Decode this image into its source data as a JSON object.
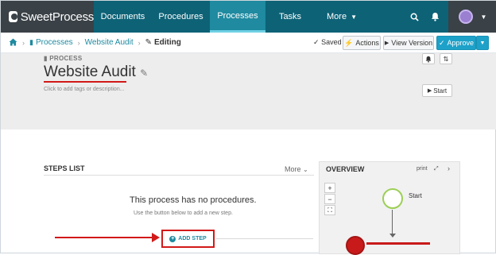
{
  "app": {
    "logo_text": "SweetProcess"
  },
  "nav": {
    "items": [
      {
        "label": "Documents"
      },
      {
        "label": "Procedures"
      },
      {
        "label": "Processes"
      },
      {
        "label": "Tasks"
      },
      {
        "label": "More"
      }
    ],
    "active": "Processes",
    "icons": [
      "search-icon",
      "bell-icon",
      "avatar",
      "chevron-down-icon"
    ]
  },
  "breadcrumb": {
    "items": [
      "Processes",
      "Website Audit"
    ],
    "current": "Editing"
  },
  "toolbar": {
    "saved_label": "Saved",
    "actions_label": "Actions",
    "view_version_label": "View Version",
    "approve_label": "Approve"
  },
  "header": {
    "kicker": "PROCESS",
    "title": "Website Audit",
    "hint": "Click to add tags or description...",
    "start_label": "Start"
  },
  "steps": {
    "heading": "STEPS LIST",
    "more_label": "More",
    "empty_title": "This process has no procedures.",
    "empty_sub": "Use the button below to add a new step.",
    "add_step_label": "ADD STEP"
  },
  "overview": {
    "heading": "OVERVIEW",
    "print_label": "print",
    "zoom_in": "+",
    "zoom_out": "−",
    "fit": "⛶",
    "start_node_label": "Start"
  },
  "colors": {
    "nav_bg": "#0d6276",
    "nav_active": "#1f8aa0",
    "accent": "#1f8aa0",
    "approve": "#1da1c9",
    "annotation_red": "#d21919",
    "start_node": "#9ccf55"
  }
}
